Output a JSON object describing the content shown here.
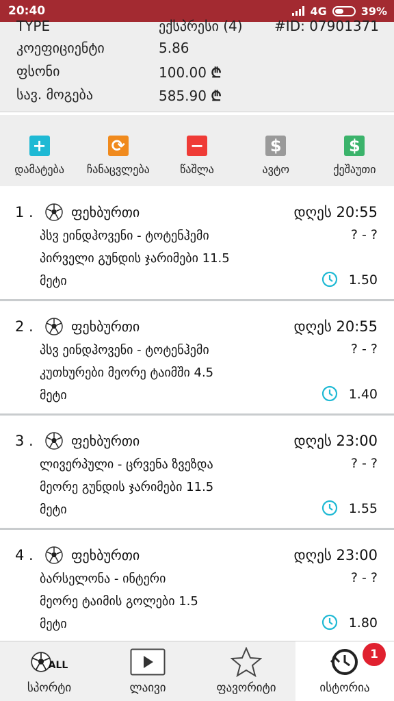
{
  "status": {
    "time": "20:40",
    "network": "4G",
    "battery": "39%"
  },
  "ticket": {
    "type_label": "TYPE",
    "type_value": "ექსპრესი (4)",
    "id": "#ID: 07901371",
    "coef_label": "კოეფიციენტი",
    "coef_value": "5.86",
    "stake_label": "ფსონი",
    "stake_value": "100.00",
    "win_label": "სავ. მოგება",
    "win_value": "585.90",
    "currency": "₾"
  },
  "actions": [
    {
      "label": "დამატება",
      "icon": "plus-icon",
      "glyph": "+",
      "color": "#1fb9d4"
    },
    {
      "label": "ჩანაცვლება",
      "icon": "swap-icon",
      "glyph": "⟳",
      "color": "#f08a1d"
    },
    {
      "label": "წაშლა",
      "icon": "minus-icon",
      "glyph": "−",
      "color": "#ef3b36"
    },
    {
      "label": "ავტო",
      "icon": "dollar-icon",
      "glyph": "$",
      "color": "#9a9a9a"
    },
    {
      "label": "ქეშაუთი",
      "icon": "dollar-icon",
      "glyph": "$",
      "color": "#3bb36b"
    }
  ],
  "bets": [
    {
      "num": "1 .",
      "sport": "ფეხბურთი",
      "time": "დღეს 20:55",
      "match": "პსვ ეინდჰოვენი - ტოტენჰემი",
      "score": "? - ?",
      "market": "პირველი გუნდის ჯარიმები 11.5",
      "outcome": "მეტი",
      "odd": "1.50"
    },
    {
      "num": "2 .",
      "sport": "ფეხბურთი",
      "time": "დღეს 20:55",
      "match": "პსვ ეინდჰოვენი - ტოტენჰემი",
      "score": "? - ?",
      "market": "კუთხურები მეორე ტაიმში 4.5",
      "outcome": "მეტი",
      "odd": "1.40"
    },
    {
      "num": "3 .",
      "sport": "ფეხბურთი",
      "time": "დღეს 23:00",
      "match": "ლივერპული - ცრვენა ზვეზდა",
      "score": "? - ?",
      "market": "მეორე გუნდის ჯარიმები 11.5",
      "outcome": "მეტი",
      "odd": "1.55"
    },
    {
      "num": "4 .",
      "sport": "ფეხბურთი",
      "time": "დღეს 23:00",
      "match": "ბარსელონა - ინტერი",
      "score": "? - ?",
      "market": "მეორე ტაიმის გოლები 1.5",
      "outcome": "მეტი",
      "odd": "1.80"
    }
  ],
  "nav": [
    {
      "label": "სპორტი",
      "icon": "sports-all-icon",
      "icon_text": "ALL"
    },
    {
      "label": "ლაივი",
      "icon": "play-icon"
    },
    {
      "label": "ფავორიტი",
      "icon": "star-icon"
    },
    {
      "label": "ისტორია",
      "icon": "history-clock-icon",
      "badge": "1",
      "active": true
    }
  ],
  "colors": {
    "statusbar": "#a32a31",
    "clock": "#1fb9d4",
    "badge": "#e0212f"
  }
}
